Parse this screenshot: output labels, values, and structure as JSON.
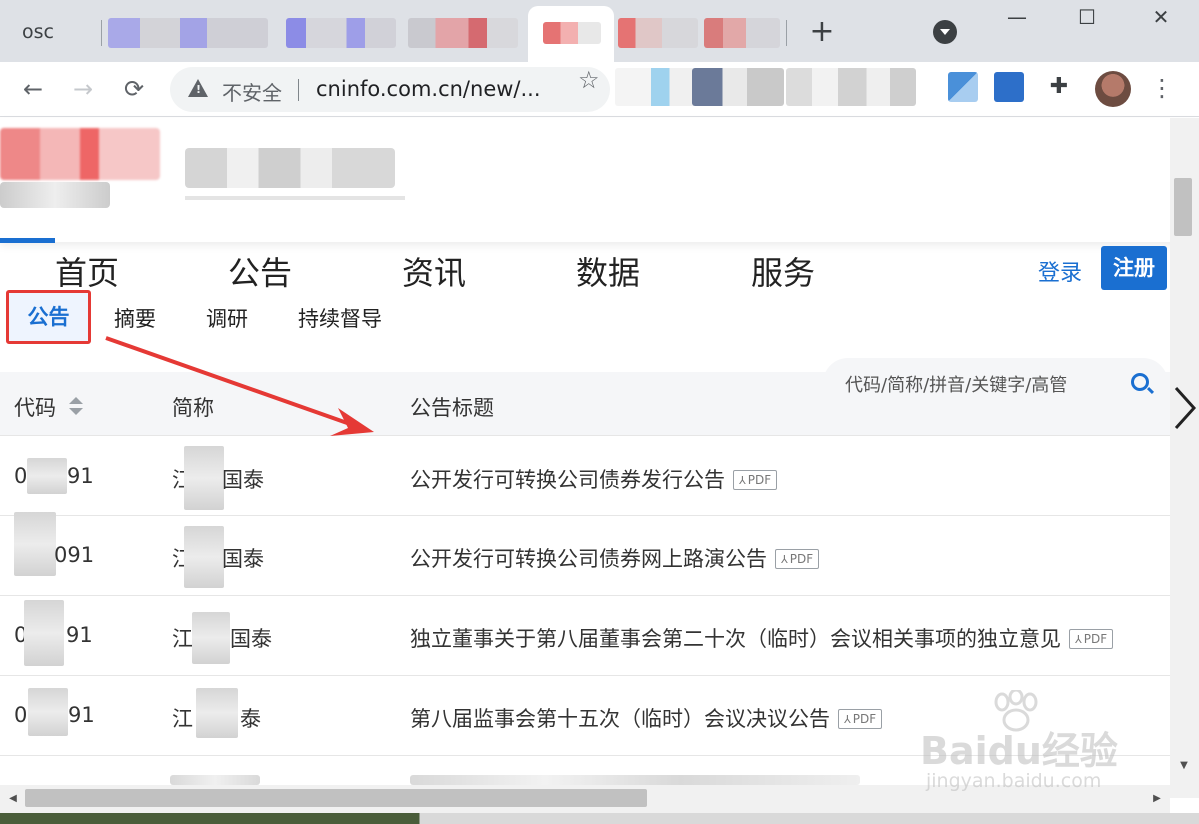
{
  "browser": {
    "first_tab_label": "osc",
    "new_tab_symbol": "+",
    "address": {
      "security_label": "不安全",
      "url": "cninfo.com.cn/new/..."
    },
    "window": {
      "minimize": "—",
      "maximize": "☐",
      "close": "✕"
    }
  },
  "site": {
    "main_nav": [
      "首页",
      "公告",
      "资讯",
      "数据",
      "服务"
    ],
    "login_label": "登录",
    "register_label": "注册",
    "sub_tabs": {
      "active": "公告",
      "others": [
        "摘要",
        "调研",
        "持续督导"
      ]
    },
    "search": {
      "placeholder": "代码/简称/拼音/关键字/高管"
    },
    "table": {
      "headers": {
        "code": "代码",
        "name": "简称",
        "title": "公告标题"
      },
      "pdf_label": "PDF",
      "rows": [
        {
          "code_a": "0",
          "code_b": "91",
          "name_a": "江",
          "name_b": "国泰",
          "title": "公开发行可转换公司债券发行公告"
        },
        {
          "code_a": "",
          "code_b": "091",
          "name_a": "江",
          "name_b": "国泰",
          "title": "公开发行可转换公司债券网上路演公告"
        },
        {
          "code_a": "0",
          "code_b": "91",
          "name_a": "江",
          "name_b": "国泰",
          "title": "独立董事关于第八届董事会第二十次（临时）会议相关事项的独立意见"
        },
        {
          "code_a": "0",
          "code_b": "91",
          "name_a": "江",
          "name_b": "泰",
          "title": "第八届监事会第十五次（临时）会议决议公告"
        }
      ]
    }
  },
  "watermark": {
    "brand": "Baidu经验",
    "domain": "jingyan.baidu.com"
  },
  "colors": {
    "accent": "#1a6fd1",
    "highlight_box": "#e53935",
    "annotation_arrow": "#e53935"
  }
}
